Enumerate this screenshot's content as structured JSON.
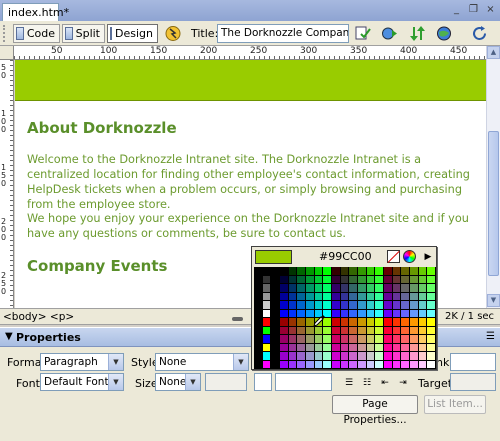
{
  "document": {
    "tab_label": "index.htm*"
  },
  "window_controls": {
    "minimize": "_",
    "restore": "❐",
    "close": "×"
  },
  "toolbar": {
    "code_label": "Code",
    "split_label": "Split",
    "design_label": "Design",
    "title_label": "Title:",
    "title_value": "The Dorknozzle Company Intranet"
  },
  "ruler": {
    "h_ticks": [
      "50",
      "100",
      "150",
      "200",
      "250",
      "300",
      "350",
      "400",
      "450"
    ],
    "v_ticks": [
      "50",
      "100",
      "150",
      "200",
      "250"
    ]
  },
  "page": {
    "banner_color": "#99CC00",
    "heading1": "About Dorknozzle",
    "para1": "Welcome to the Dorknozzle Intranet site. The Dorknozzle Intranet is a centralized location for finding other employee's contact information, creating HelpDesk tickets when a problem occurs, or simply browsing and purchasing from the employee store.",
    "para2": "We hope you enjoy your experience on the Dorknozzle Intranet site and if you have any questions or comments, be sure to contact us.",
    "heading2": "Company Events",
    "text_color": "#6C9B2F"
  },
  "status_bar": {
    "tags": "<body> <p>",
    "download_info": "2K / 1 sec"
  },
  "properties": {
    "header": "Properties",
    "format_label": "Format",
    "format_value": "Paragraph",
    "style_label": "Style",
    "style_value": "None",
    "font_label": "Font",
    "font_value": "Default Font",
    "size_label": "Size",
    "size_value": "None",
    "link_label_partial": "nk",
    "target_label": "Target",
    "page_properties_button": "Page Properties...",
    "list_item_button": "List Item..."
  },
  "color_picker": {
    "selected_hex": "#99CC00",
    "selected_color": "#99cc00"
  },
  "icons": [
    "code-view-icon",
    "split-view-icon",
    "design-view-icon",
    "live-data-icon",
    "validate-icon",
    "preview-icon",
    "file-management-icon",
    "browser-check-icon",
    "refresh-icon",
    "eyedropper-icon",
    "no-color-icon",
    "color-wheel-icon"
  ]
}
